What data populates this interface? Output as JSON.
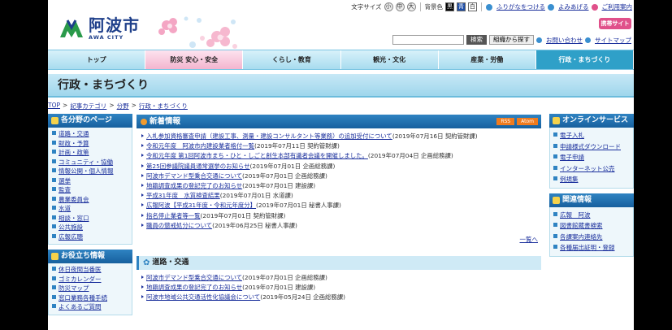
{
  "util": {
    "font_size_label": "文字サイズ",
    "sizes": [
      "小",
      "中",
      "大"
    ],
    "bg_label": "背景色",
    "bg_colors": [
      "黒",
      "青",
      "白"
    ],
    "furigana": "ふりがなをつける",
    "yomiageru": "よみあげる",
    "guide": "ご利用案内"
  },
  "header": {
    "city_name": "阿波市",
    "city_sub": "AWA CITY",
    "mobile_site": "携帯サイト"
  },
  "search": {
    "placeholder": "",
    "search_button": "検索",
    "org_search": "組織から探す",
    "contact": "お問い合わせ",
    "sitemap": "サイトマップ"
  },
  "nav": [
    "トップ",
    "防災 安心・安全",
    "くらし・教育",
    "観光・文化",
    "産業・労働",
    "行政・まちづくり"
  ],
  "page_title": "行政・まちづくり",
  "breadcrumb": [
    "TOP",
    "記事カテゴリ",
    "分野",
    "行政・まちづくり"
  ],
  "left": {
    "bunya_title": "各分野のページ",
    "bunya": [
      "道路・交通",
      "財政・予算",
      "計画・政策",
      "コミュニティ・協働",
      "情報公開・個人情報",
      "選挙",
      "監査",
      "農業委員会",
      "水道",
      "相談・窓口",
      "公共施設",
      "広報広聴"
    ],
    "yaku_title": "お役立ち情報",
    "yaku": [
      "休日夜間当番医",
      "ゴミカレンダー",
      "防災マップ",
      "窓口業務各種手続",
      "よくあるご質問"
    ]
  },
  "news": {
    "title": "新着情報",
    "rss": "RSS",
    "atom": "Atom",
    "items": [
      {
        "title": "入札参加資格審査申請（建設工事、測量・建設コンサルタント等業務）の追加受付について",
        "meta": "(2019年07月16日 契約管財課)"
      },
      {
        "title": "令和元年度　阿波市内建設業者格付一覧",
        "meta": "(2019年07月11日 契約管財課)"
      },
      {
        "title": "令和元年度 第1回阿波市まち・ひと・しごと創生本部有識者会議を開催しました。",
        "meta": "(2019年07月04日 企画総務課)"
      },
      {
        "title": "第25回参議院議員通常選挙のお知らせ",
        "meta": "(2019年07月01日 企画総務課)"
      },
      {
        "title": "阿波市デマンド型乗合交通について",
        "meta": "(2019年07月01日 企画総務課)"
      },
      {
        "title": "地籍調査成果の登記完了のお知らせ",
        "meta": "(2019年07月01日 建設課)"
      },
      {
        "title": "平成31年度　水質検査結果",
        "meta": "(2019年07月01日 水道課)"
      },
      {
        "title": "広報阿波【平成31年度・令和元年度分】",
        "meta": "(2019年07月01日 秘書人事課)"
      },
      {
        "title": "指名停止業者等一覧",
        "meta": "(2019年07月01日 契約管財課)"
      },
      {
        "title": "職員の懲戒処分について",
        "meta": "(2019年06月25日 秘書人事課)"
      }
    ],
    "more": "一覧へ"
  },
  "road": {
    "title": "道路・交通",
    "items": [
      {
        "title": "阿波市デマンド型乗合交通について",
        "meta": "(2019年07月01日 企画総務課)"
      },
      {
        "title": "地籍調査成果の登記完了のお知らせ",
        "meta": "(2019年07月01日 建設課)"
      },
      {
        "title": "阿波市地域公共交通活性化協議会について",
        "meta": "(2019年05月24日 企画総務課)"
      }
    ]
  },
  "right": {
    "online_title": "オンラインサービス",
    "online": [
      "電子入札",
      "申請様式ダウンロード",
      "電子申請",
      "インターネット公売",
      "例規集"
    ],
    "related_title": "関連情報",
    "related": [
      "広報　阿波",
      "図書館蔵書検索",
      "各課案内連絡先",
      "各種届出証明・登録"
    ]
  },
  "colors": {
    "primary": "#17609e",
    "nav_active": "#2fa0c8",
    "banner": "#c7e8f6",
    "pink": "#f3b5cf",
    "feed": "#f07b1e"
  }
}
